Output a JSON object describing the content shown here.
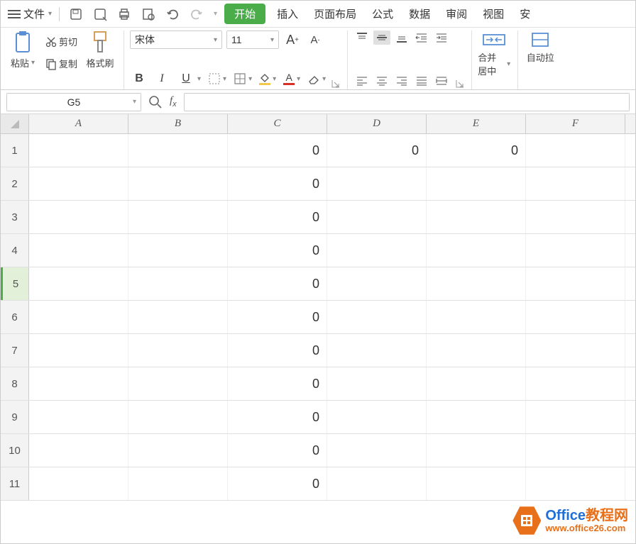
{
  "menu": {
    "file": "文件",
    "tabs": [
      "开始",
      "插入",
      "页面布局",
      "公式",
      "数据",
      "审阅",
      "视图",
      "安"
    ]
  },
  "clipboard": {
    "paste": "粘贴",
    "cut": "剪切",
    "copy": "复制",
    "format": "格式刷"
  },
  "font": {
    "name": "宋体",
    "size": "11"
  },
  "merge": {
    "label": "合并居中"
  },
  "auto": {
    "label": "自动拉"
  },
  "namebox": "G5",
  "columns": [
    "A",
    "B",
    "C",
    "D",
    "E",
    "F"
  ],
  "rows": [
    {
      "n": "1",
      "C": "0",
      "D": "0",
      "E": "0"
    },
    {
      "n": "2",
      "C": "0"
    },
    {
      "n": "3",
      "C": "0"
    },
    {
      "n": "4",
      "C": "0"
    },
    {
      "n": "5",
      "C": "0"
    },
    {
      "n": "6",
      "C": "0"
    },
    {
      "n": "7",
      "C": "0"
    },
    {
      "n": "8",
      "C": "0"
    },
    {
      "n": "9",
      "C": "0"
    },
    {
      "n": "10",
      "C": "0"
    },
    {
      "n": "11",
      "C": "0"
    }
  ],
  "selectedRow": 5,
  "watermark": {
    "t1a": "Office",
    "t1b": "教程网",
    "t2": "www.office26.com"
  }
}
